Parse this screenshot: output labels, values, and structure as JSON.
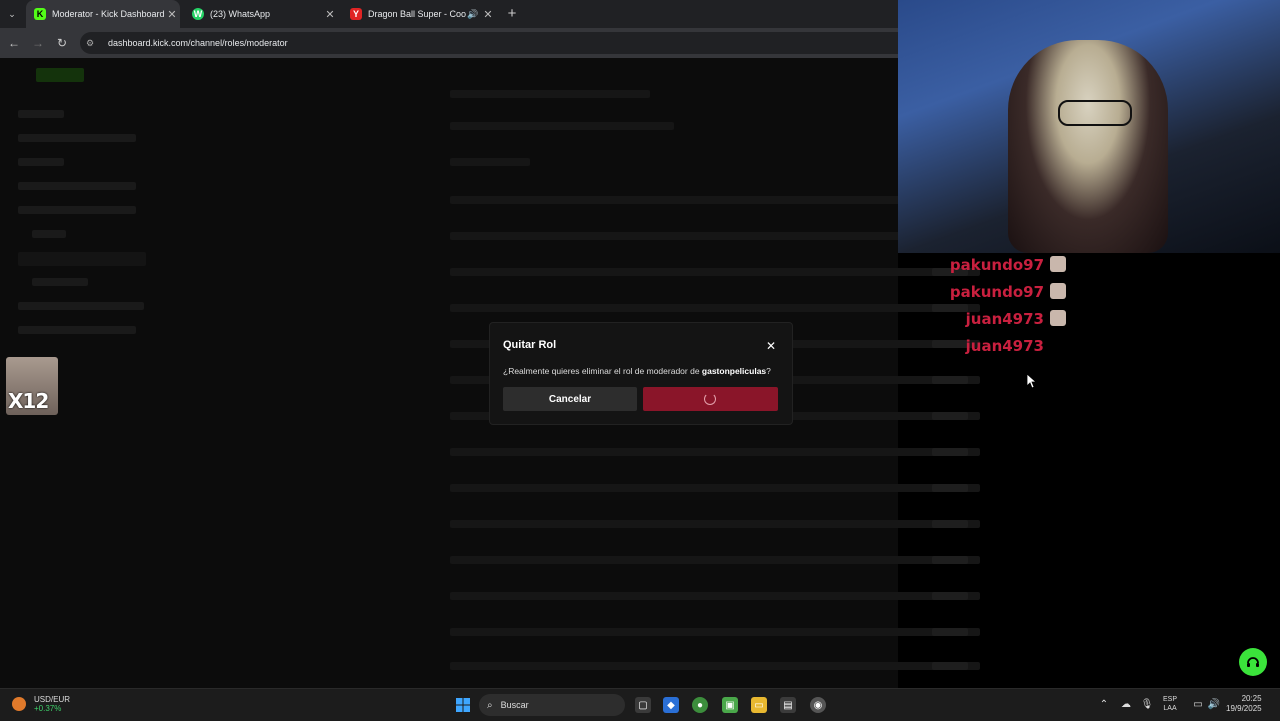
{
  "browser": {
    "tabs": [
      {
        "label": "Moderator - Kick Dashboard",
        "favicon": "K"
      },
      {
        "label": "(23) WhatsApp",
        "favicon": "W"
      },
      {
        "label": "Dragon Ball Super - Coordi",
        "favicon": "Y"
      }
    ],
    "url": "dashboard.kick.com/channel/roles/moderator"
  },
  "modal": {
    "title": "Quitar Rol",
    "message_prefix": "¿Realmente quieres eliminar el rol de moderador de ",
    "username": "gastonpeliculas",
    "message_suffix": "?",
    "cancel_label": "Cancelar",
    "confirm_state": "loading"
  },
  "chat": {
    "messages": [
      {
        "user": "pakundo97",
        "badge": true
      },
      {
        "user": "pakundo97",
        "badge": true
      },
      {
        "user": "juan4973",
        "badge": true
      },
      {
        "user": "juan4973",
        "badge": false
      }
    ]
  },
  "overlay": {
    "text": "X12"
  },
  "taskbar": {
    "ticker_symbol": "USD/EUR",
    "ticker_change": "+0.37%",
    "search_label": "Buscar",
    "lang_top": "ESP",
    "lang_bottom": "LAA",
    "time": "20:25",
    "date": "19/9/2025"
  },
  "colors": {
    "kick_green": "#53fc18",
    "chat_red": "#c9203f",
    "confirm_red": "#8a1529"
  }
}
